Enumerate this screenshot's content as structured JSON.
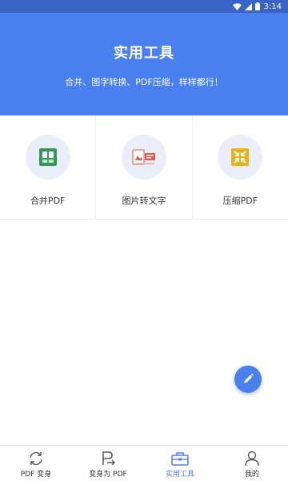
{
  "status_bar": {
    "time": "3:14",
    "icons": [
      "wifi-icon",
      "signal-icon",
      "battery-icon"
    ]
  },
  "header": {
    "title": "实用工具",
    "subtitle": "合并、图字转换、PDF压缩，样样都行！"
  },
  "tools": [
    {
      "label": "合并PDF",
      "icon": "merge-pdf-icon"
    },
    {
      "label": "图片转文字",
      "icon": "image-to-text-icon"
    },
    {
      "label": "压缩PDF",
      "icon": "compress-pdf-icon"
    }
  ],
  "fab": {
    "icon": "edit-icon"
  },
  "tabbar": {
    "active": 2,
    "tabs": [
      {
        "label": "PDF 变身",
        "icon": "convert-icon"
      },
      {
        "label": "变身为 PDF",
        "icon": "to-pdf-icon"
      },
      {
        "label": "实用工具",
        "icon": "toolbox-icon"
      },
      {
        "label": "我的",
        "icon": "user-icon"
      }
    ]
  },
  "colors": {
    "primary": "#4a7ff0",
    "status_bar": "#3a63c8",
    "tool_circle_bg": "#e9eef8"
  }
}
